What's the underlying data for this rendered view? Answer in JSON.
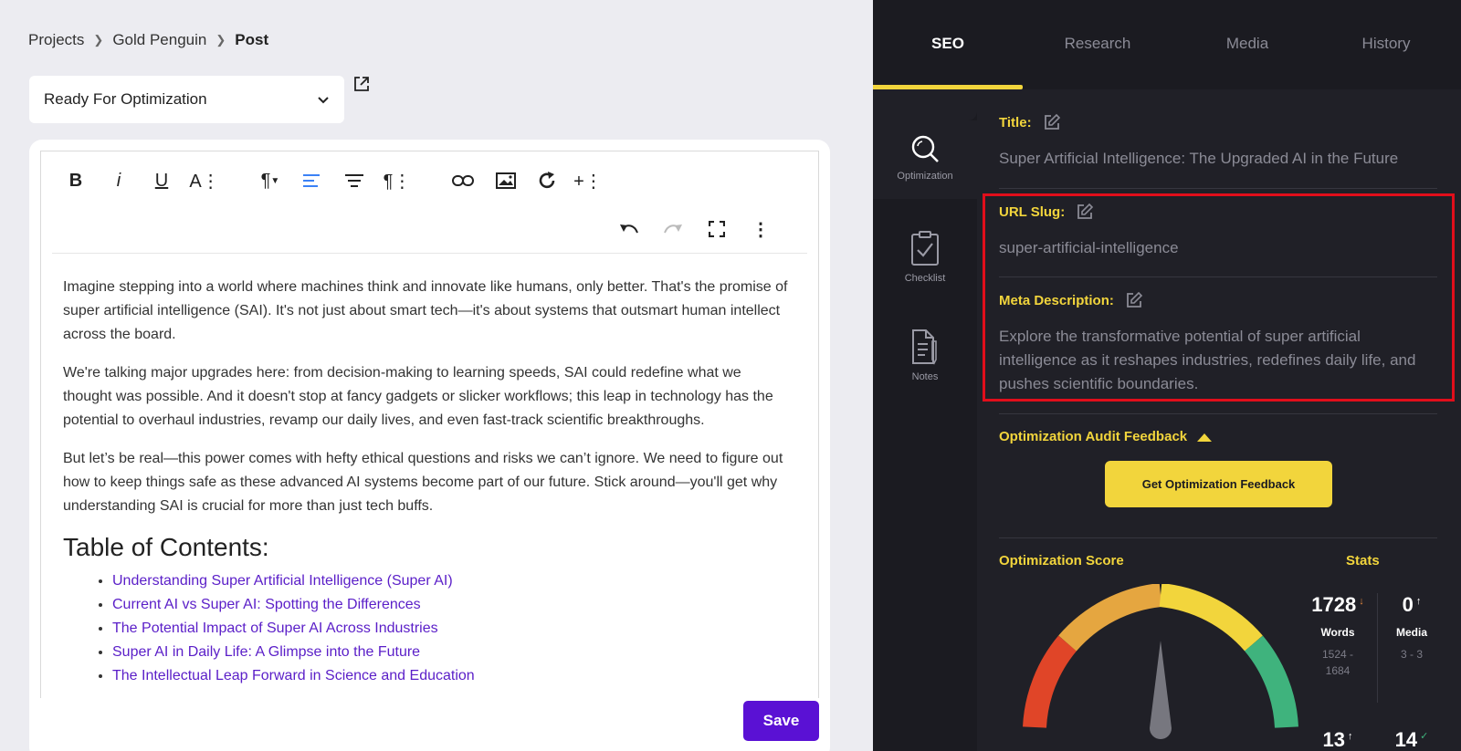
{
  "breadcrumb": {
    "items": [
      "Projects",
      "Gold Penguin"
    ],
    "current": "Post"
  },
  "status": {
    "value": "Ready For Optimization"
  },
  "editor": {
    "paragraphs": [
      "Imagine stepping into a world where machines think and innovate like humans, only better. That's the promise of super artificial intelligence (SAI). It's not just about smart tech—it's about systems that outsmart human intellect across the board.",
      "We're talking major upgrades here: from decision-making to learning speeds, SAI could redefine what we thought was possible. And it doesn't stop at fancy gadgets or slicker workflows; this leap in technology has the potential to overhaul industries, revamp our daily lives, and even fast-track scientific breakthroughs.",
      "But let’s be real—this power comes with hefty ethical questions and risks we can’t ignore. We need to figure out how to keep things safe as these advanced AI systems become part of our future. Stick around—you'll get why understanding SAI is crucial for more than just tech buffs."
    ],
    "toc_heading": "Table of Contents:",
    "toc_items": [
      "Understanding Super Artificial Intelligence (Super AI)",
      "Current AI vs Super AI: Spotting the Differences",
      "The Potential Impact of Super AI Across Industries",
      "Super AI in Daily Life: A Glimpse into the Future",
      "The Intellectual Leap Forward in Science and Education"
    ],
    "save_label": "Save"
  },
  "tabs": [
    "SEO",
    "Research",
    "Media",
    "History"
  ],
  "rail": {
    "optimization": "Optimization",
    "checklist": "Checklist",
    "notes": "Notes"
  },
  "seo": {
    "title_label": "Title:",
    "title_value": "Super Artificial Intelligence: The Upgraded AI in the Future",
    "slug_label": "URL Slug:",
    "slug_value": "super-artificial-intelligence",
    "meta_label": "Meta Description:",
    "meta_value": "Explore the transformative potential of super artificial intelligence as it reshapes industries, redefines daily life, and pushes scientific boundaries.",
    "audit_label": "Optimization Audit Feedback",
    "feedback_button": "Get Optimization Feedback",
    "score_label": "Optimization Score",
    "stats_label": "Stats"
  },
  "stats": {
    "words": {
      "num": "1728",
      "name": "Words",
      "range_a": "1524 -",
      "range_b": "1684"
    },
    "media": {
      "num": "0",
      "name": "Media",
      "range": "3 - 3"
    },
    "row2_a": "13",
    "row2_b": "14"
  },
  "colors": {
    "accent": "#f2d53c",
    "save": "#5a11d4",
    "link": "#5a1ec8",
    "highlight": "#e10e1b"
  }
}
